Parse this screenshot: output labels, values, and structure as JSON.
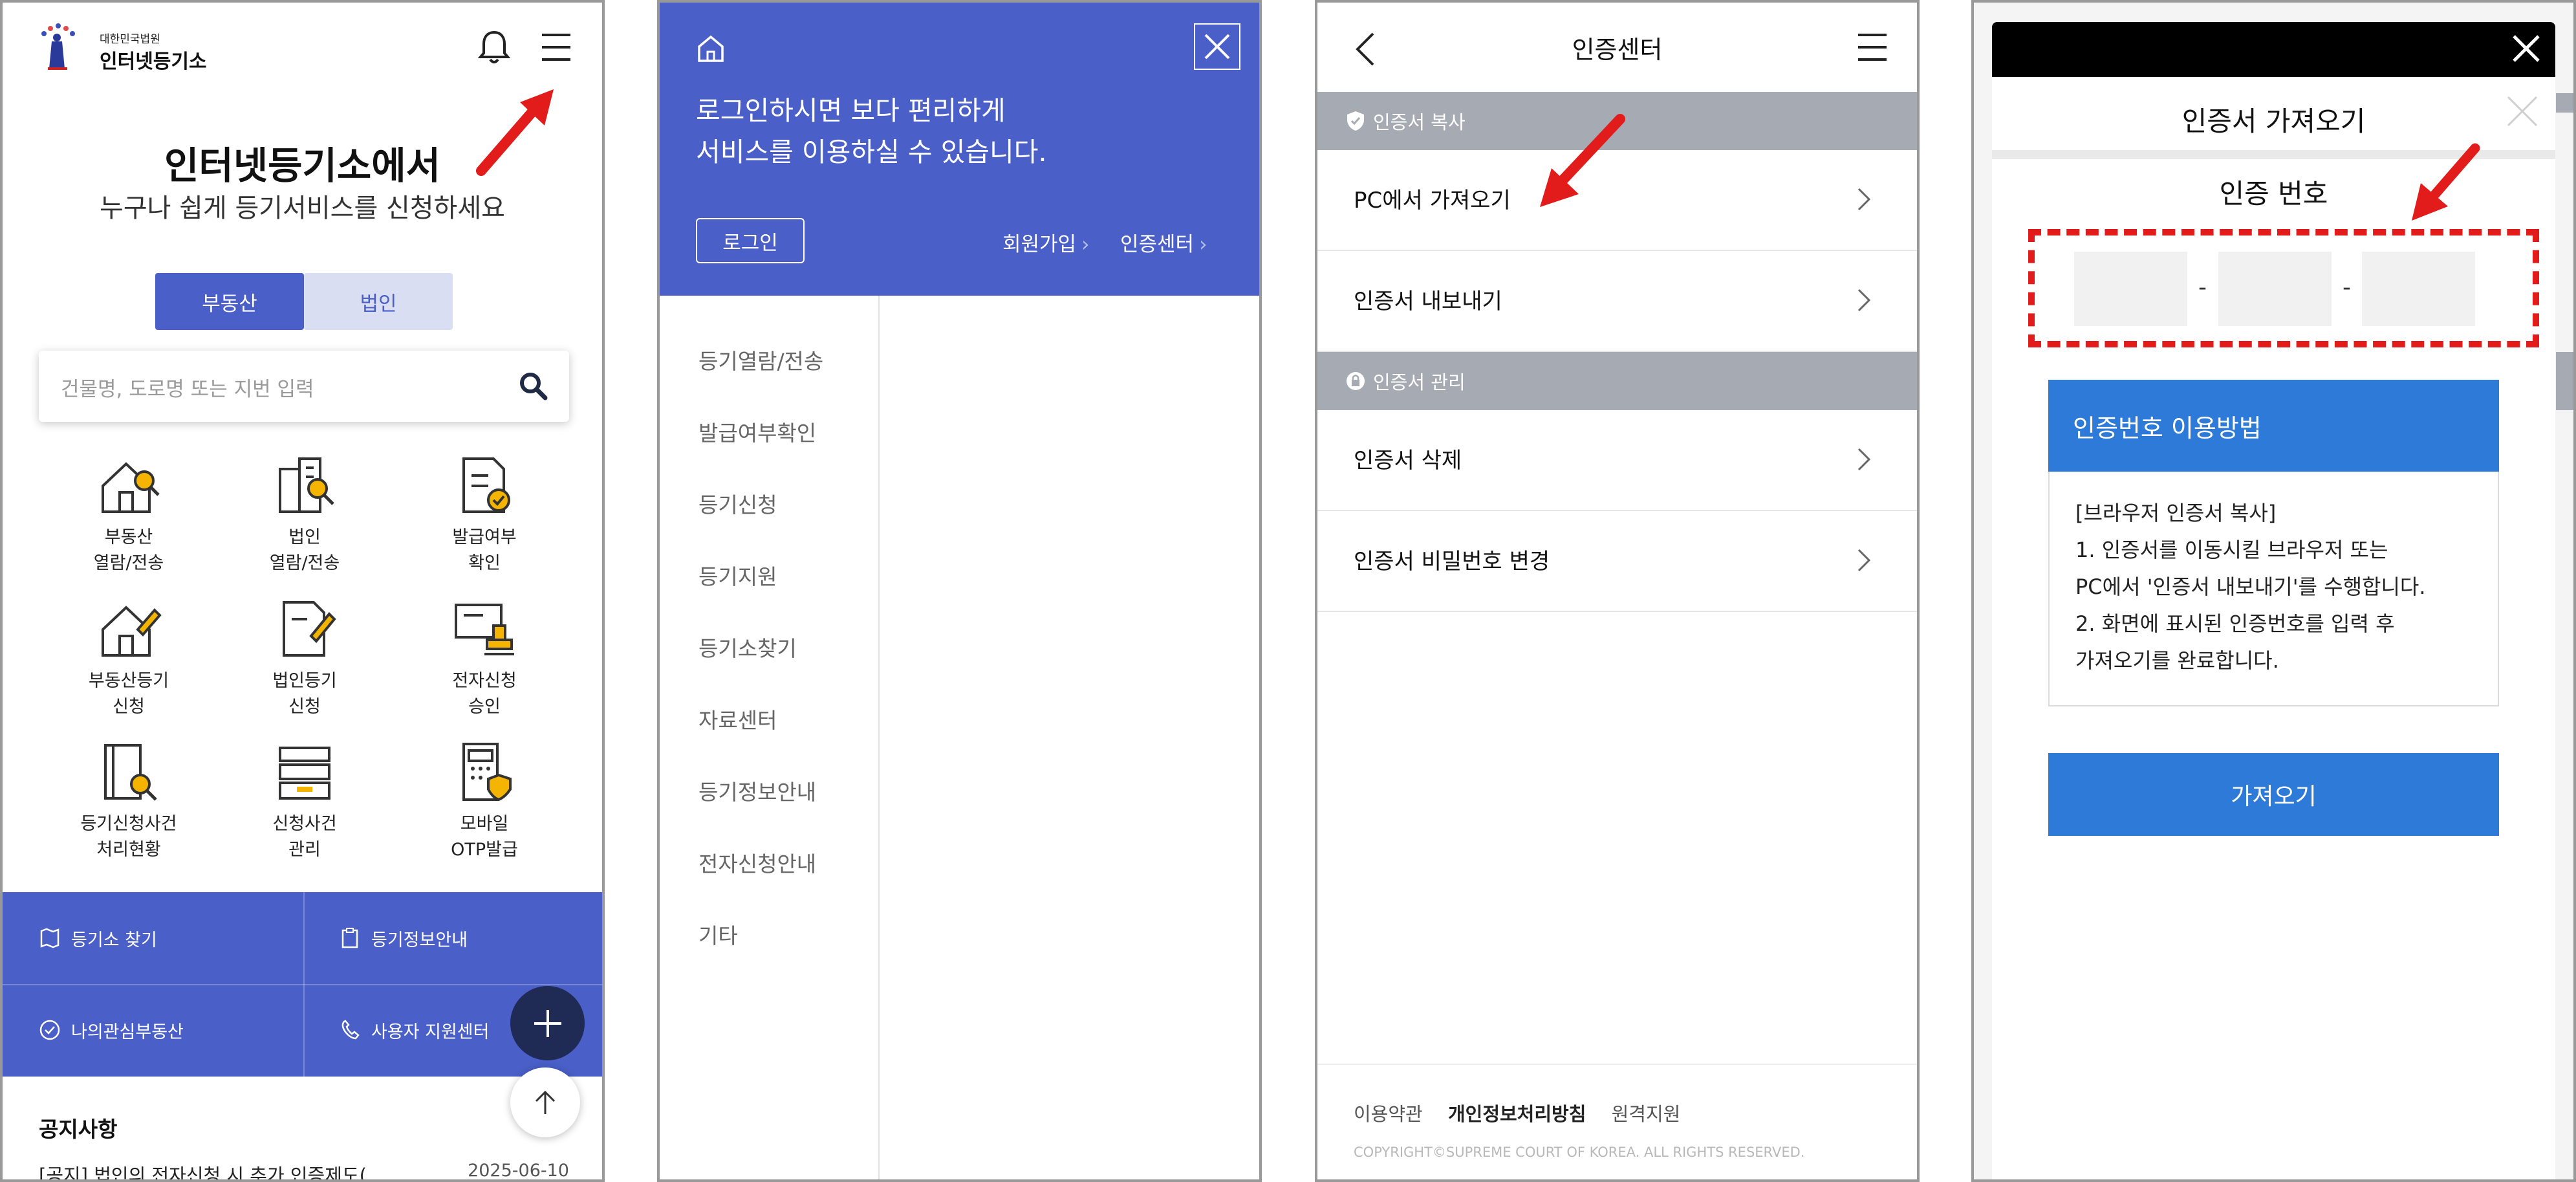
{
  "panel1": {
    "logo": {
      "small": "대한민국법원",
      "big": "인터넷등기소"
    },
    "hero_title": "인터넷등기소에서",
    "hero_sub": "누구나 쉽게 등기서비스를 신청하세요",
    "tabs": [
      "부동산",
      "법인"
    ],
    "search_placeholder": "건물명, 도로명 또는 지번 입력",
    "services": [
      {
        "icon": "house-search-icon",
        "line1": "부동산",
        "line2": "열람/전송"
      },
      {
        "icon": "building-search-icon",
        "line1": "법인",
        "line2": "열람/전송"
      },
      {
        "icon": "document-check-icon",
        "line1": "발급여부",
        "line2": "확인"
      },
      {
        "icon": "house-edit-icon",
        "line1": "부동산등기",
        "line2": "신청"
      },
      {
        "icon": "building-edit-icon",
        "line1": "법인등기",
        "line2": "신청"
      },
      {
        "icon": "stamp-approval-icon",
        "line1": "전자신청",
        "line2": "승인"
      },
      {
        "icon": "book-search-icon",
        "line1": "등기신청사건",
        "line2": "처리현황"
      },
      {
        "icon": "inbox-tray-icon",
        "line1": "신청사건",
        "line2": "관리"
      },
      {
        "icon": "otp-calculator-icon",
        "line1": "모바일",
        "line2": "OTP발급"
      }
    ],
    "quick_links": [
      "등기소 찾기",
      "등기정보안내",
      "나의관심부동산",
      "사용자 지원센터"
    ],
    "notice_title": "공지사항",
    "notice_item": "[공지] 법인의 전자신청 시 추가 인증제도(…",
    "notice_date": "2025-06-10"
  },
  "panel2": {
    "message_line1": "로그인하시면 보다 편리하게",
    "message_line2": "서비스를 이용하실 수 있습니다.",
    "login": "로그인",
    "signup": "회원가입",
    "cert_center": "인증센터",
    "menu": [
      "등기열람/전송",
      "발급여부확인",
      "등기신청",
      "등기지원",
      "등기소찾기",
      "자료센터",
      "등기정보안내",
      "전자신청안내",
      "기타"
    ]
  },
  "panel3": {
    "title": "인증센터",
    "section1": "인증서 복사",
    "section1_items": [
      "PC에서 가져오기",
      "인증서 내보내기"
    ],
    "section2": "인증서 관리",
    "section2_items": [
      "인증서 삭제",
      "인증서 비밀번호 변경"
    ],
    "footer_links": [
      "이용약관",
      "개인정보처리방침",
      "원격지원"
    ],
    "copyright": "COPYRIGHT©SUPREME COURT OF KOREA. ALL RIGHTS RESERVED."
  },
  "panel4": {
    "modal_title": "인증서 가져오기",
    "auth_label": "인증 번호",
    "dash": "-",
    "help_title": "인증번호 이용방법",
    "help_lines": [
      "[브라우저 인증서 복사]",
      "1. 인증서를 이동시킬 브라우저 또는",
      "PC에서 '인증서 내보내기'를 수행합니다.",
      "2. 화면에 표시된 인증번호를 입력 후",
      "가져오기를 완료합니다."
    ],
    "import_button": "가져오기"
  },
  "colors": {
    "brand_blue": "#4a5fc8",
    "action_blue": "#2d7ad8",
    "highlight_red": "#e21b1b",
    "section_gray": "#a6abb3"
  }
}
